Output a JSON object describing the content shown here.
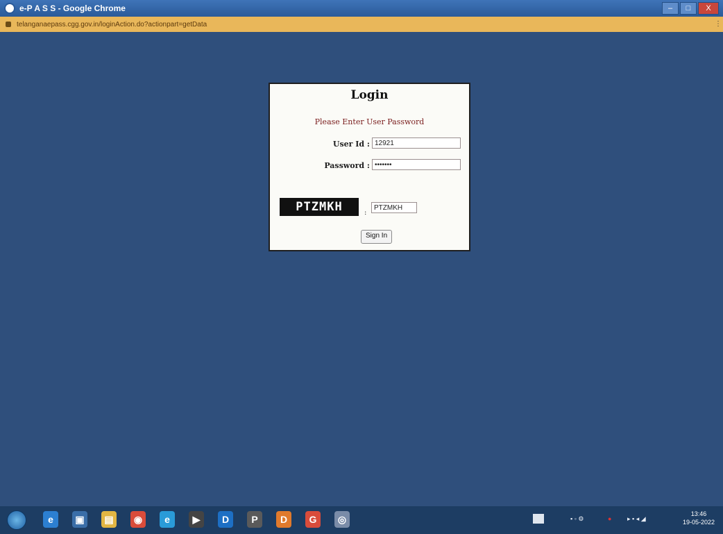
{
  "window": {
    "title": "e-P A S S - Google Chrome",
    "controls": {
      "minimize": "–",
      "maximize": "□",
      "close": "X"
    }
  },
  "address_bar": {
    "url": "telanganaepass.cgg.gov.in/loginAction.do?actionpart=getData",
    "menu": "⋮"
  },
  "login": {
    "heading": "Login",
    "subtitle": "Please Enter User Password",
    "user_id_label": "User Id :",
    "user_id_value": "12921",
    "password_label": "Password :",
    "password_value": "•••••••",
    "captcha_text": "PTZMKH",
    "captcha_separator": ":",
    "captcha_input_value": "PTZMKH",
    "signin_label": "Sign In"
  },
  "taskbar": {
    "icons": [
      {
        "name": "ie-icon",
        "glyph": "e",
        "color": "#2c7fd1"
      },
      {
        "name": "store-icon",
        "glyph": "▣",
        "color": "#3a6ea8"
      },
      {
        "name": "folder-icon",
        "glyph": "▤",
        "color": "#e2b643"
      },
      {
        "name": "chrome-icon",
        "glyph": "◉",
        "color": "#d94c3b"
      },
      {
        "name": "edge-icon",
        "glyph": "e",
        "color": "#2a9bd8"
      },
      {
        "name": "media-icon",
        "glyph": "▶",
        "color": "#444"
      },
      {
        "name": "app-d-icon",
        "glyph": "D",
        "color": "#1d6fc4"
      },
      {
        "name": "app-p-icon",
        "glyph": "P",
        "color": "#5a5a5a"
      },
      {
        "name": "app-o-icon",
        "glyph": "D",
        "color": "#e07a2c"
      },
      {
        "name": "chrome-active-icon",
        "glyph": "G",
        "color": "#d94c3b"
      },
      {
        "name": "app-g-icon",
        "glyph": "◎",
        "color": "#7a8ca8"
      }
    ],
    "clock_time": "13:46",
    "clock_date": "19-05-2022"
  }
}
